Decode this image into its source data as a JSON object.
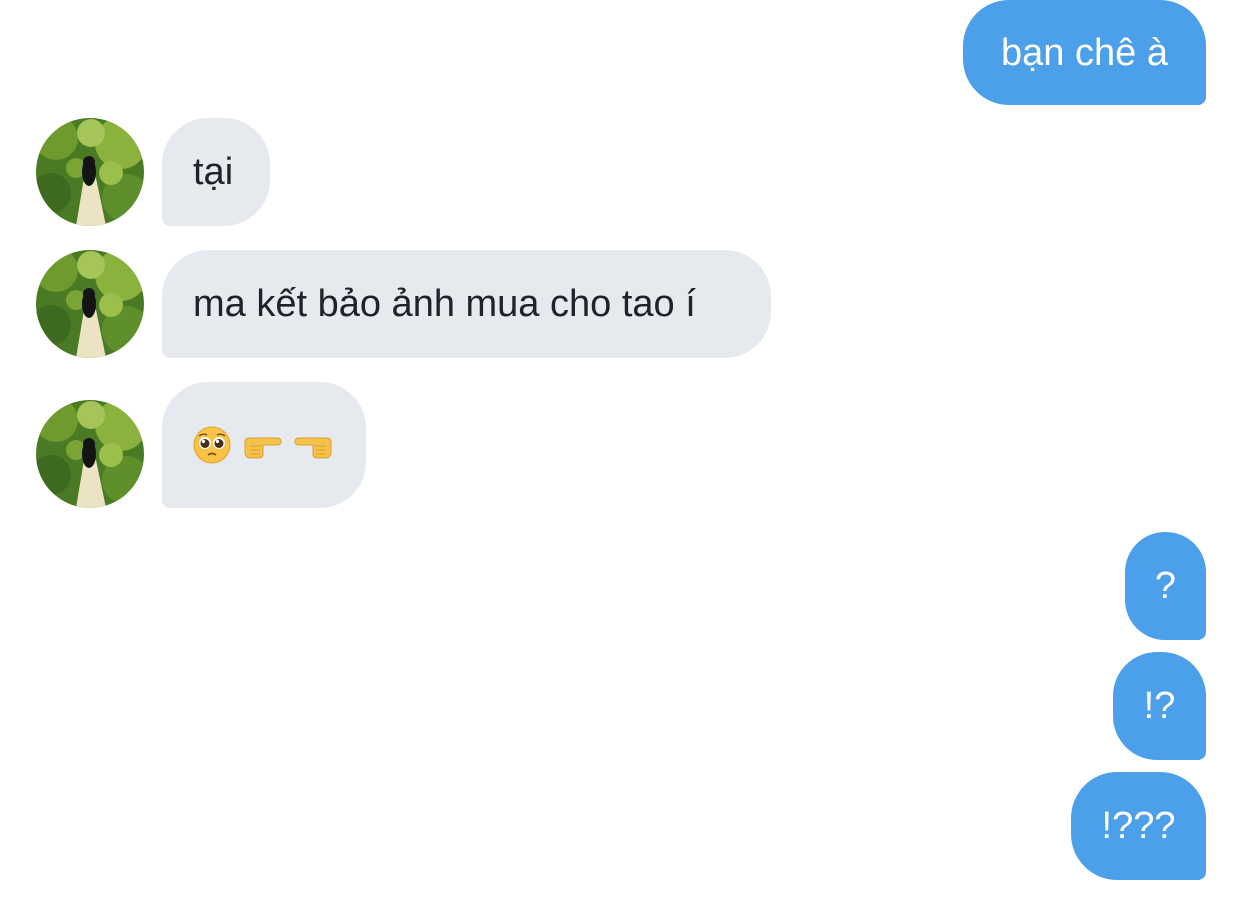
{
  "conversation": {
    "messages": [
      {
        "from": "me",
        "text": "bạn chê à"
      },
      {
        "from": "them",
        "text": "tại"
      },
      {
        "from": "them",
        "text": "ma kết bảo ảnh mua cho tao í"
      },
      {
        "from": "them",
        "text": "🥺👉👈",
        "emoji_names": [
          "pleading-face-icon",
          "pointing-right-icon",
          "pointing-left-icon"
        ]
      },
      {
        "from": "me",
        "text": "?"
      },
      {
        "from": "me",
        "text": "!?"
      },
      {
        "from": "me",
        "text": "!???"
      }
    ]
  },
  "colors": {
    "outgoing_bubble": "#4c9fe9",
    "incoming_bubble": "#e6e9ee",
    "incoming_text": "#1f2329",
    "outgoing_text": "#ffffff"
  }
}
